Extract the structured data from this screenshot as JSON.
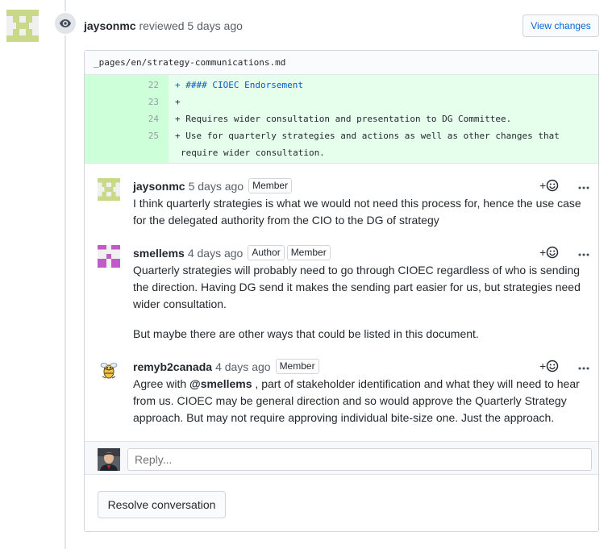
{
  "review": {
    "author": "jaysonmc",
    "action": "reviewed",
    "time": "5 days ago",
    "view_changes_label": "View changes"
  },
  "file": {
    "path": "_pages/en/strategy-communications.md"
  },
  "diff": {
    "lines": [
      {
        "number": "22",
        "text": "+ #### CIOEC Endorsement"
      },
      {
        "number": "23",
        "text": "+"
      },
      {
        "number": "24",
        "text": "+ Requires wider consultation and presentation to DG Committee."
      },
      {
        "number": "25",
        "text": "+ Use for quarterly strategies and actions as well as other changes that"
      }
    ],
    "continuation": "require wider consultation."
  },
  "comments": [
    {
      "author": "jaysonmc",
      "time": "5 days ago",
      "badges": [
        "Member"
      ],
      "body": [
        "I think quarterly strategies is what we would not need this process for, hence the use case for the delegated authority from the CIO to the DG of strategy"
      ]
    },
    {
      "author": "smellems",
      "time": "4 days ago",
      "badges": [
        "Author",
        "Member"
      ],
      "body": [
        "Quarterly strategies will probably need to go through CIOEC regardless of who is sending the direction. Having DG send it makes the sending part easier for us, but strategies need wider consultation.",
        "But maybe there are other ways that could be listed in this document."
      ]
    },
    {
      "author": "remyb2canada",
      "time": "4 days ago",
      "badges": [
        "Member"
      ],
      "body_prefix": "Agree with ",
      "mention": "@smellems",
      "body_suffix": " , part of stakeholder identification and what they will need to hear from us. CIOEC may be general direction and so would approve the Quarterly Strategy approach. But may not require approving individual bite-size one. Just the approach."
    }
  ],
  "reply": {
    "placeholder": "Reply..."
  },
  "resolve_label": "Resolve conversation",
  "icons": {
    "reviewed": "eye-icon",
    "reaction": "smiley-plus-icon",
    "more": "kebab-horizontal-icon"
  },
  "colors": {
    "link": "#0366d6",
    "diff_added_bg": "#e6ffed",
    "diff_added_gutter": "#cdffd8",
    "heading_code": "#005cc5"
  }
}
